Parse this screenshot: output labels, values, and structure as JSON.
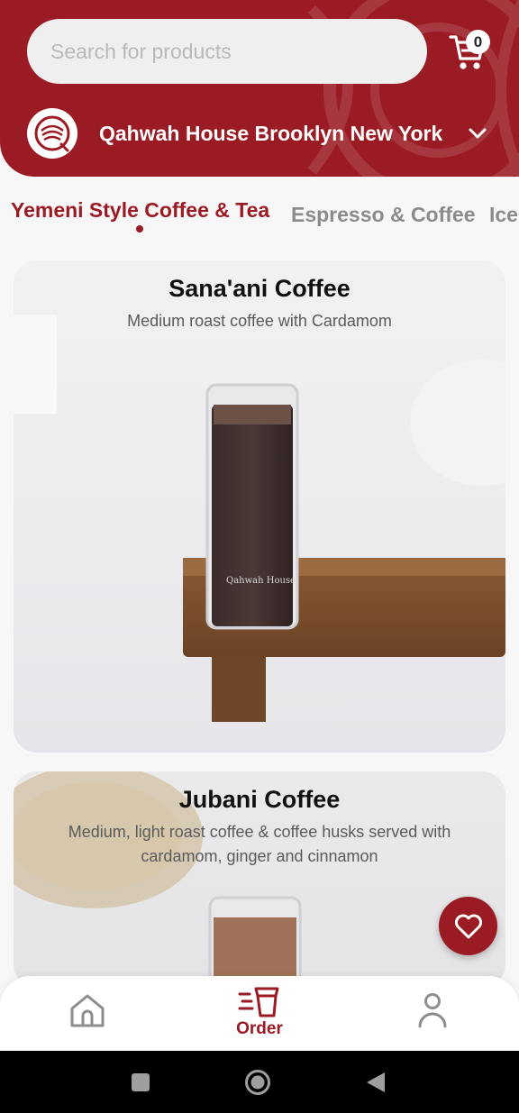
{
  "search": {
    "placeholder": "Search for products"
  },
  "cart": {
    "count": "0",
    "icon": "cart-icon"
  },
  "store": {
    "name": "Qahwah House Brooklyn New York"
  },
  "categories": [
    {
      "label": "Yemeni Style Coffee & Tea",
      "active": true
    },
    {
      "label": "Espresso & Coffee",
      "active": false
    },
    {
      "label": "Ice",
      "active": false
    }
  ],
  "products": [
    {
      "title": "Sana'ani Coffee",
      "description": "Medium roast coffee with Cardamom"
    },
    {
      "title": "Jubani Coffee",
      "description_line1": "Medium, light roast coffee & coffee husks served with",
      "description_line2": "cardamom, ginger and cinnamon"
    }
  ],
  "bottom_nav": {
    "order_label": "Order"
  },
  "colors": {
    "brand": "#9a1b24",
    "background": "#f7f7f7"
  }
}
